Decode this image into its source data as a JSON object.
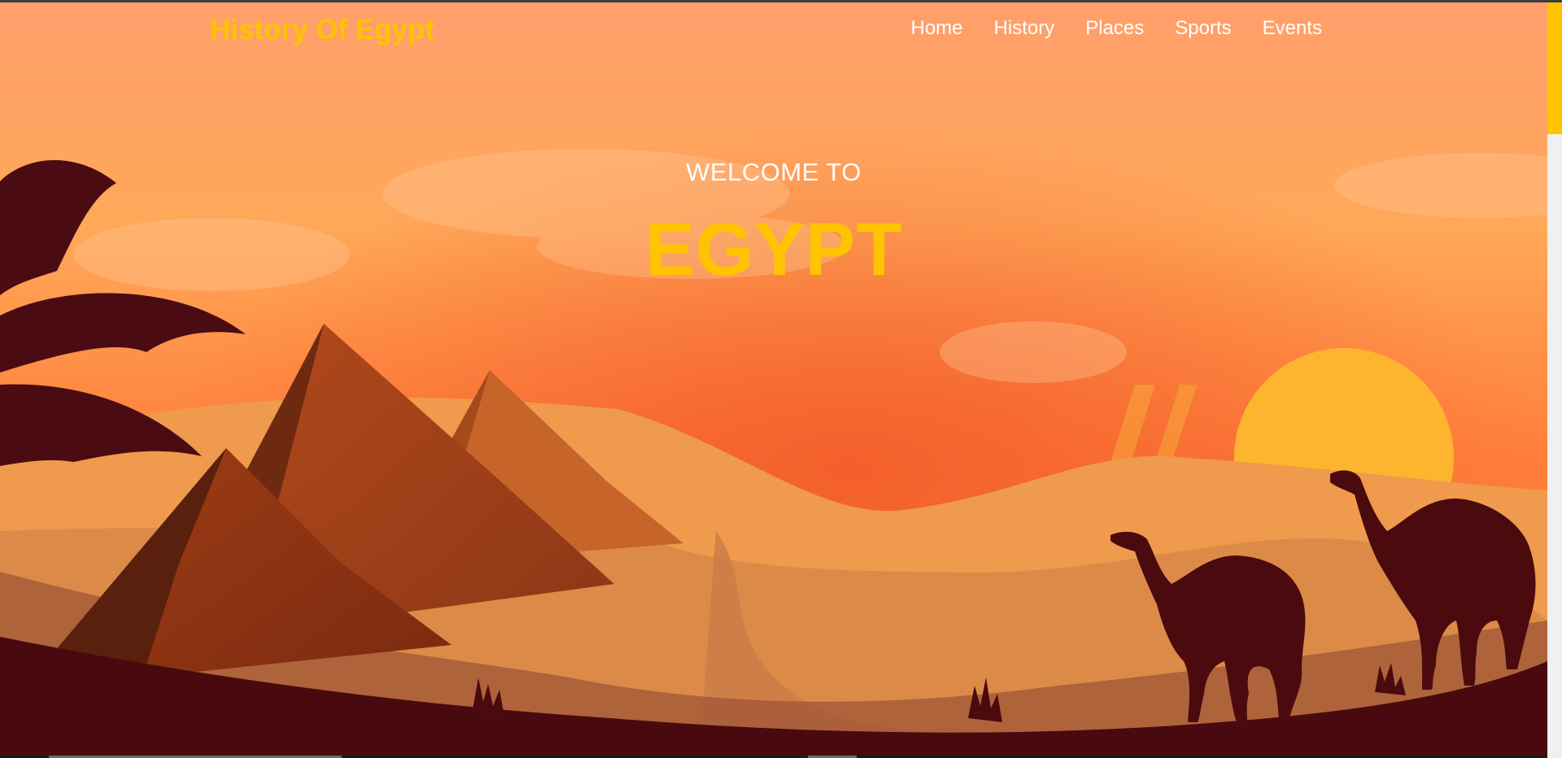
{
  "brand": {
    "title": "History Of Egypt",
    "accent": "#ffc300"
  },
  "nav": {
    "items": [
      {
        "label": "Home"
      },
      {
        "label": "History"
      },
      {
        "label": "Places"
      },
      {
        "label": "Sports"
      },
      {
        "label": "Events"
      }
    ]
  },
  "hero": {
    "subtitle": "WELCOME TO",
    "title": "EGYPT",
    "illustration": "desert-sunset-pyramids-camels"
  },
  "scrollbar": {
    "position": 0,
    "thumb_color": "#ffc300"
  }
}
